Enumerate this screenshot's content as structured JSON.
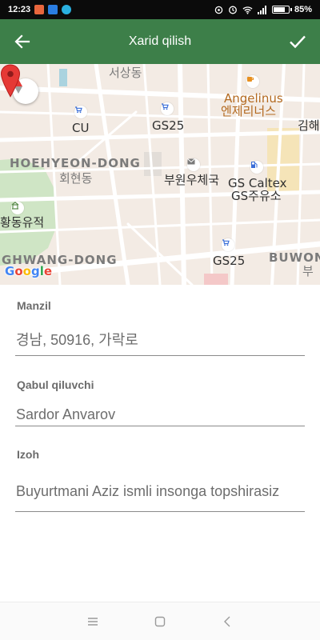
{
  "status_bar": {
    "time": "12:23",
    "battery_percent": "85%",
    "battery_level": 0.85,
    "left_icons": [
      "calendar-app-icon",
      "media-icon",
      "app-icon"
    ],
    "right_icons": [
      "location-icon",
      "alarm-icon",
      "wifi-icon",
      "signal-icon",
      "battery-icon"
    ]
  },
  "app_bar": {
    "title": "Xarid qilish",
    "back_icon": "arrow-left-icon",
    "confirm_icon": "check-icon",
    "background": "#3d7f49"
  },
  "map": {
    "labels": {
      "seosang": "서상동",
      "angelinus_en": "Angelinus",
      "angelinus_ko": "엔제리너스",
      "cu": "CU",
      "gs25_top": "GS25",
      "kimhae": "김해",
      "hoehyeon_en": "HOEHYEON-DONG",
      "hoehyeon_ko": "회현동",
      "post_office": "부원우체국",
      "gs_caltex_en": "GS Caltex",
      "gs_caltex_ko": "GS주유소",
      "relic_site": "황동유적",
      "ghwang_dong": "GHWANG-DONG",
      "gs25_bottom": "GS25",
      "buwon": "BUWON",
      "buwon_ko_partial": "부"
    },
    "logo": "Google",
    "compass_icon": "compass-icon",
    "pin_icon": "location-pin-icon"
  },
  "form": {
    "address": {
      "label": "Manzil",
      "value": "경남, 50916, 가락로"
    },
    "recipient": {
      "label": "Qabul qiluvchi",
      "value": "Sardor Anvarov"
    },
    "note": {
      "label": "Izoh",
      "value": "Buyurtmani Aziz ismli insonga topshirasiz"
    }
  },
  "nav_bar": {
    "icons": [
      "menu-icon",
      "home-icon",
      "back-icon"
    ]
  }
}
